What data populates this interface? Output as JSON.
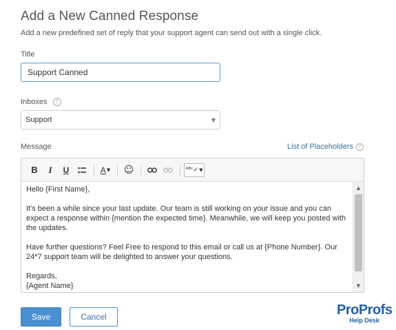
{
  "header": {
    "title": "Add a New Canned Response",
    "subtitle": "Add a new predefined set of reply that your support agent can send out with a single click."
  },
  "form": {
    "title_label": "Title",
    "title_value": "Support Canned",
    "inboxes_label": "Inboxes",
    "inboxes_selected": "Support",
    "message_label": "Message",
    "placeholders_link": "List of Placeholders"
  },
  "toolbar": {
    "bold": "B",
    "italic": "I",
    "underline": "U",
    "list": "☰",
    "font_color": "A",
    "emoji": "☺",
    "link": "⛓",
    "unlink": "⛓",
    "spellcheck": "ᴬᴮᶜ✓"
  },
  "editor": {
    "greeting": "Hello {First Name},",
    "para1": "It's been a while since your last update. Our team is still working on your issue and you can expect a response within {mention the expected time}. Meanwhile, we will keep you posted with the updates.",
    "para2": "Have further questions? Feel Free to respond to this email or call us at {Phone Number}. Our 24*7 support team will be delighted to answer your questions.",
    "closing": "Regards,",
    "signature": "{Agent Name}"
  },
  "actions": {
    "save_label": "Save",
    "cancel_label": "Cancel"
  },
  "logo": {
    "brand_part1": "Pro",
    "brand_part2": "Profs",
    "product": "Help Desk"
  },
  "colors": {
    "accent": "#4a90d0",
    "link": "#3a6ea5",
    "brand": "#1f5fa8"
  }
}
